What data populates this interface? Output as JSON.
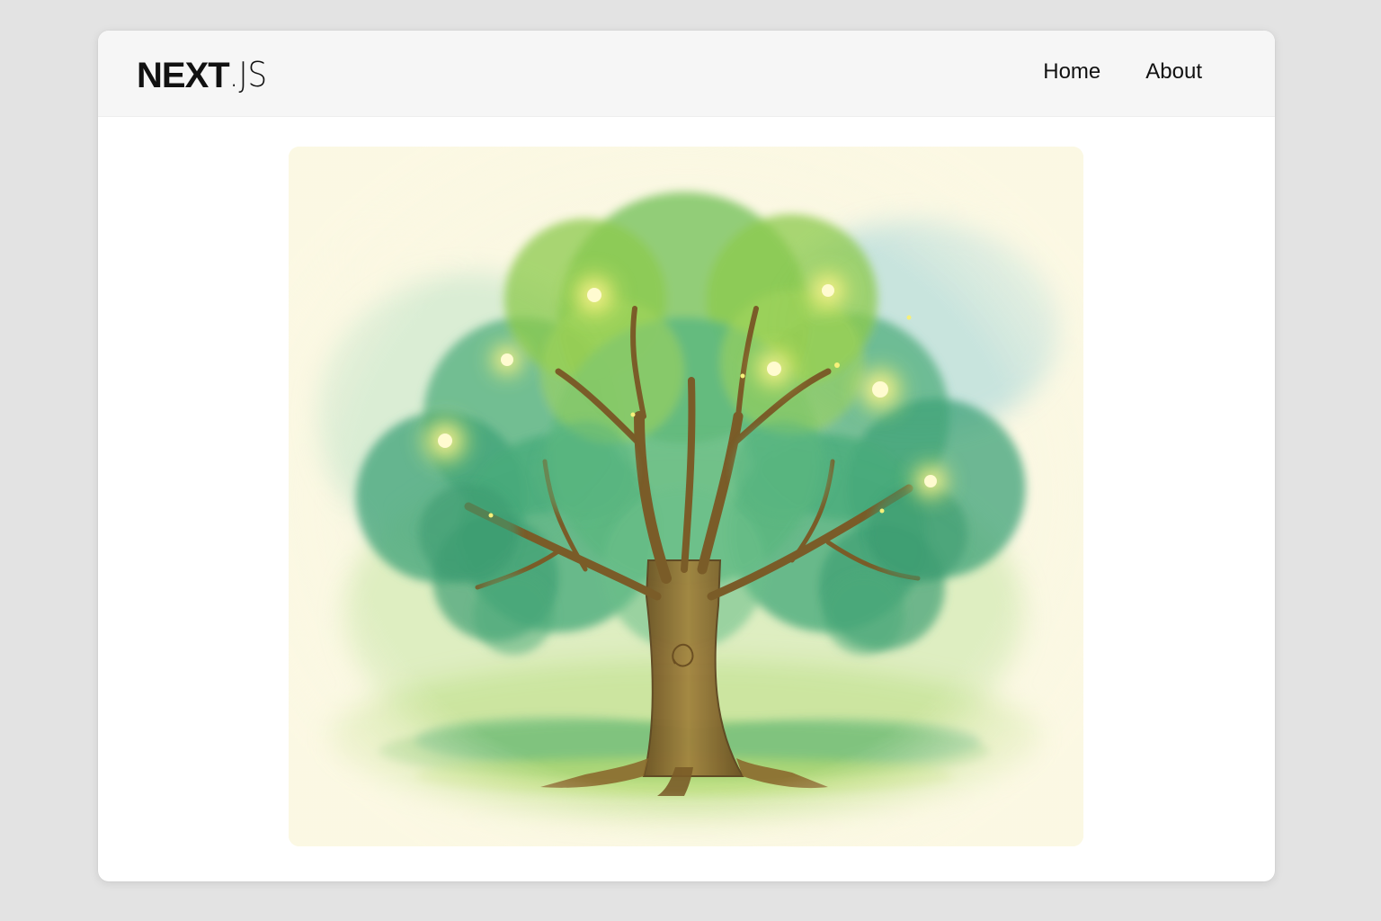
{
  "navbar": {
    "logo_bold": "NEXT",
    "logo_thin": ".JS",
    "links": [
      {
        "label": "Home"
      },
      {
        "label": "About"
      }
    ]
  },
  "hero": {
    "image_subject": "watercolor-tree-with-glowing-lights",
    "colors": {
      "paper": "#fbf8e3",
      "foliage": "#4fae7c",
      "foliage_light": "#a8d35a",
      "trunk": "#8b6a2e",
      "glow": "#fff27a",
      "sky_wash": "#9fd3d8"
    }
  },
  "colors": {
    "page_background": "#e3e3e3",
    "navbar_background": "#f6f6f6",
    "text": "#111111"
  }
}
